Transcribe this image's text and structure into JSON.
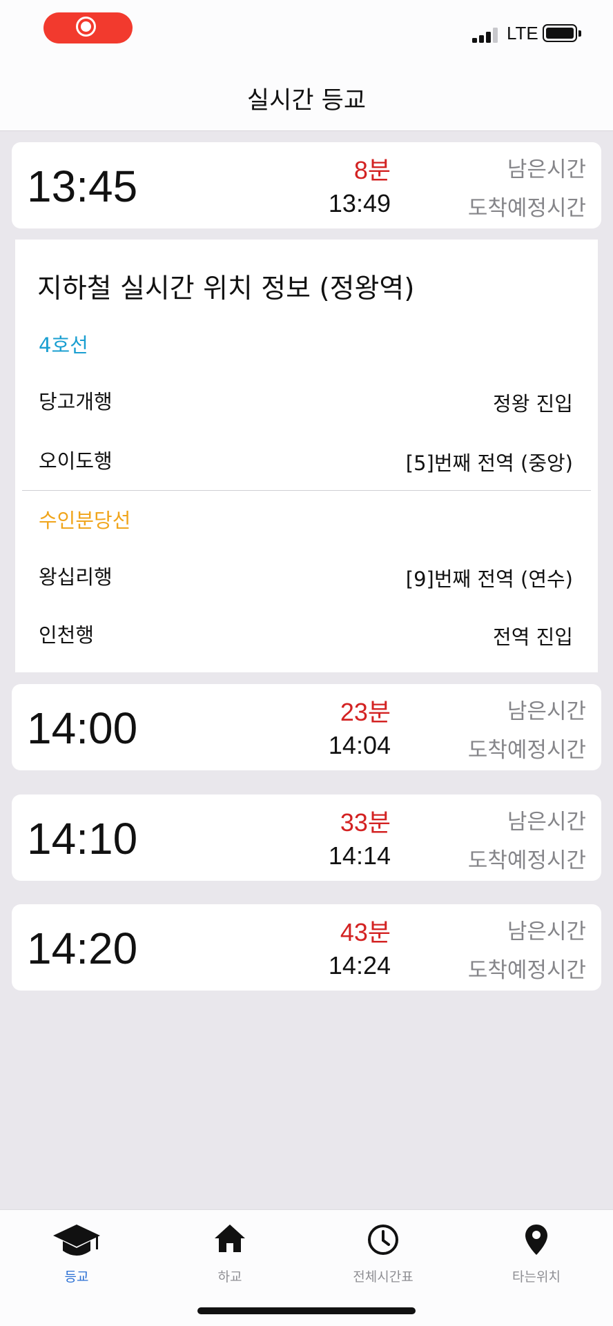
{
  "status": {
    "network": "LTE"
  },
  "nav": {
    "title": "실시간 등교"
  },
  "cards": [
    {
      "departure": "13:45",
      "remaining": "8분",
      "arrival": "13:49",
      "remaining_label": "남은시간",
      "arrival_label": "도착예정시간"
    },
    {
      "departure": "14:00",
      "remaining": "23분",
      "arrival": "14:04",
      "remaining_label": "남은시간",
      "arrival_label": "도착예정시간"
    },
    {
      "departure": "14:10",
      "remaining": "33분",
      "arrival": "14:14",
      "remaining_label": "남은시간",
      "arrival_label": "도착예정시간"
    },
    {
      "departure": "14:20",
      "remaining": "43분",
      "arrival": "14:24",
      "remaining_label": "남은시간",
      "arrival_label": "도착예정시간"
    }
  ],
  "subway": {
    "heading": "지하철 실시간 위치 정보 (정왕역)",
    "lines": [
      {
        "name": "4호선",
        "color": "#1a9fd1",
        "trains": [
          {
            "destination": "당고개행",
            "status": "정왕 진입"
          },
          {
            "destination": "오이도행",
            "status": "[5]번째 전역 (중앙)"
          }
        ]
      },
      {
        "name": "수인분당선",
        "color": "#f0a51c",
        "trains": [
          {
            "destination": "왕십리행",
            "status": "[9]번째 전역 (연수)"
          },
          {
            "destination": "인천행",
            "status": "전역 진입"
          }
        ]
      }
    ]
  },
  "tabs": [
    {
      "label": "등교",
      "icon": "graduation-cap-icon",
      "active": true
    },
    {
      "label": "하교",
      "icon": "home-icon",
      "active": false
    },
    {
      "label": "전체시간표",
      "icon": "clock-icon",
      "active": false
    },
    {
      "label": "타는위치",
      "icon": "location-pin-icon",
      "active": false
    }
  ],
  "colors": {
    "accent": "#2a6fd4",
    "remaining": "#d32222",
    "record": "#f23a2e"
  }
}
